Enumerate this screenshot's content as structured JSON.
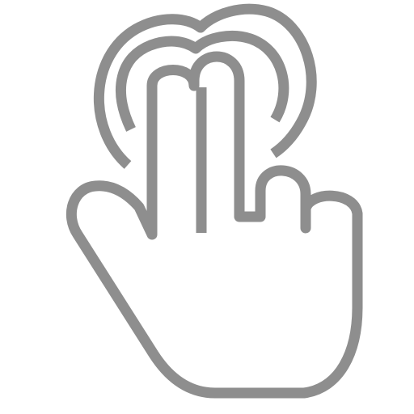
{
  "icon": {
    "name": "two-finger-tap-icon",
    "stroke_color": "#8e8e8e",
    "fill_color": "#ffffff",
    "background_color": "#ffffff"
  }
}
